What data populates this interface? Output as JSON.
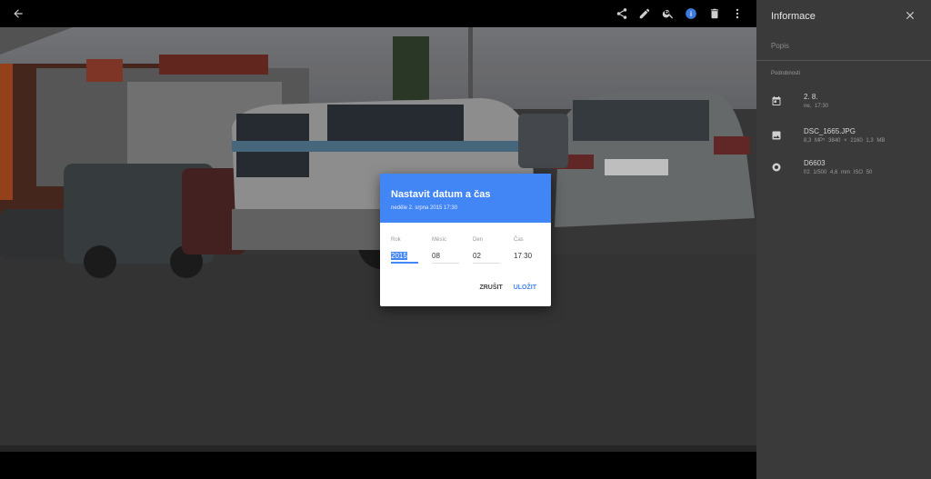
{
  "viewer": {
    "icons": [
      "back-arrow-icon",
      "share-icon",
      "edit-icon",
      "zoom-icon",
      "info-icon",
      "delete-icon",
      "more-vert-icon"
    ]
  },
  "panel": {
    "title": "Informace",
    "description_placeholder": "Popis",
    "details_label": "Podrobnosti",
    "date": {
      "main": "2. 8.",
      "sub": "ne, 17:30"
    },
    "file": {
      "main": "DSC_1665.JPG",
      "sub": "8,3 MP⁵   3840 × 2160   1,3 MB"
    },
    "camera": {
      "main": "D6603",
      "sub": "f/2   1/500   4,6 mm   ISO 50"
    }
  },
  "dialog": {
    "title": "Nastavit datum a čas",
    "subtitle": "neděle 2. srpna 2015 17:30",
    "fields": {
      "year_label": "Rok",
      "year": "2015",
      "month_label": "Měsíc",
      "month": "08",
      "day_label": "Den",
      "day": "02",
      "time_label": "Čas",
      "hour": "17",
      "minute": "30"
    },
    "cancel": "ZRUŠIT",
    "save": "ULOŽIT"
  },
  "colors": {
    "accent": "#4285f4",
    "panel_bg": "#3a3a3a"
  }
}
